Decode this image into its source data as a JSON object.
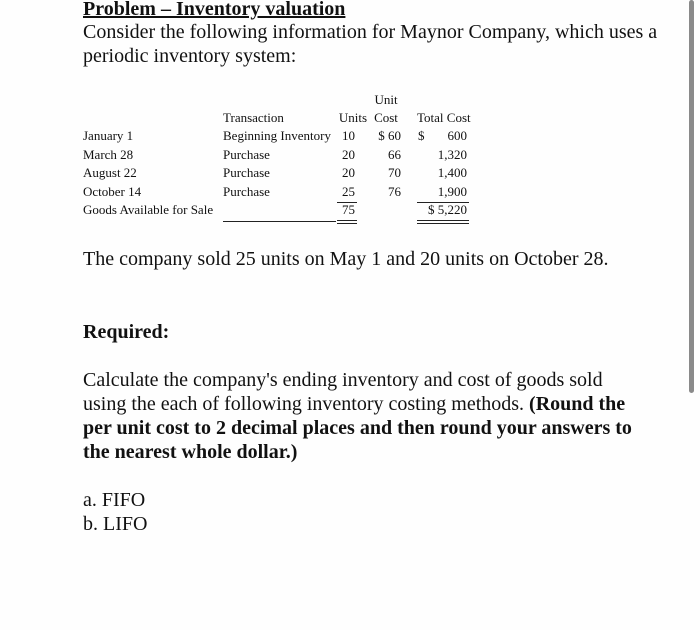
{
  "document": {
    "title": "Problem – Inventory valuation",
    "intro": "Consider the following information for Maynor Company, which uses a periodic inventory system:",
    "table": {
      "headers": {
        "transaction": "Transaction",
        "units": "Units",
        "unit_cost_line1": "Unit",
        "unit_cost_line2": "Cost",
        "total_cost": "Total Cost"
      },
      "rows": [
        {
          "date": "January 1",
          "transaction": "Beginning Inventory",
          "units": "10",
          "unit_cost": "$ 60",
          "total_cost_symbol": "$",
          "total_cost": "600"
        },
        {
          "date": "March 28",
          "transaction": "Purchase",
          "units": "20",
          "unit_cost": "66",
          "total_cost_symbol": "",
          "total_cost": "1,320"
        },
        {
          "date": "August 22",
          "transaction": "Purchase",
          "units": "20",
          "unit_cost": "70",
          "total_cost_symbol": "",
          "total_cost": "1,400"
        },
        {
          "date": "October 14",
          "transaction": "Purchase",
          "units": "25",
          "unit_cost": "76",
          "total_cost_symbol": "",
          "total_cost": "1,900"
        }
      ],
      "total_row": {
        "label": "Goods Available for Sale",
        "units": "75",
        "total_cost": "$ 5,220"
      }
    },
    "sales_text": "The company sold 25 units on May 1 and 20 units on October 28.",
    "required_heading": "Required:",
    "instructions_plain": "Calculate the company's ending inventory and cost of goods sold using the each of following inventory costing methods. ",
    "instructions_bold": "(Round the per unit cost to 2 decimal places and then round your answers to the nearest whole dollar.)",
    "methods": [
      "a. FIFO",
      "b. LIFO"
    ]
  }
}
